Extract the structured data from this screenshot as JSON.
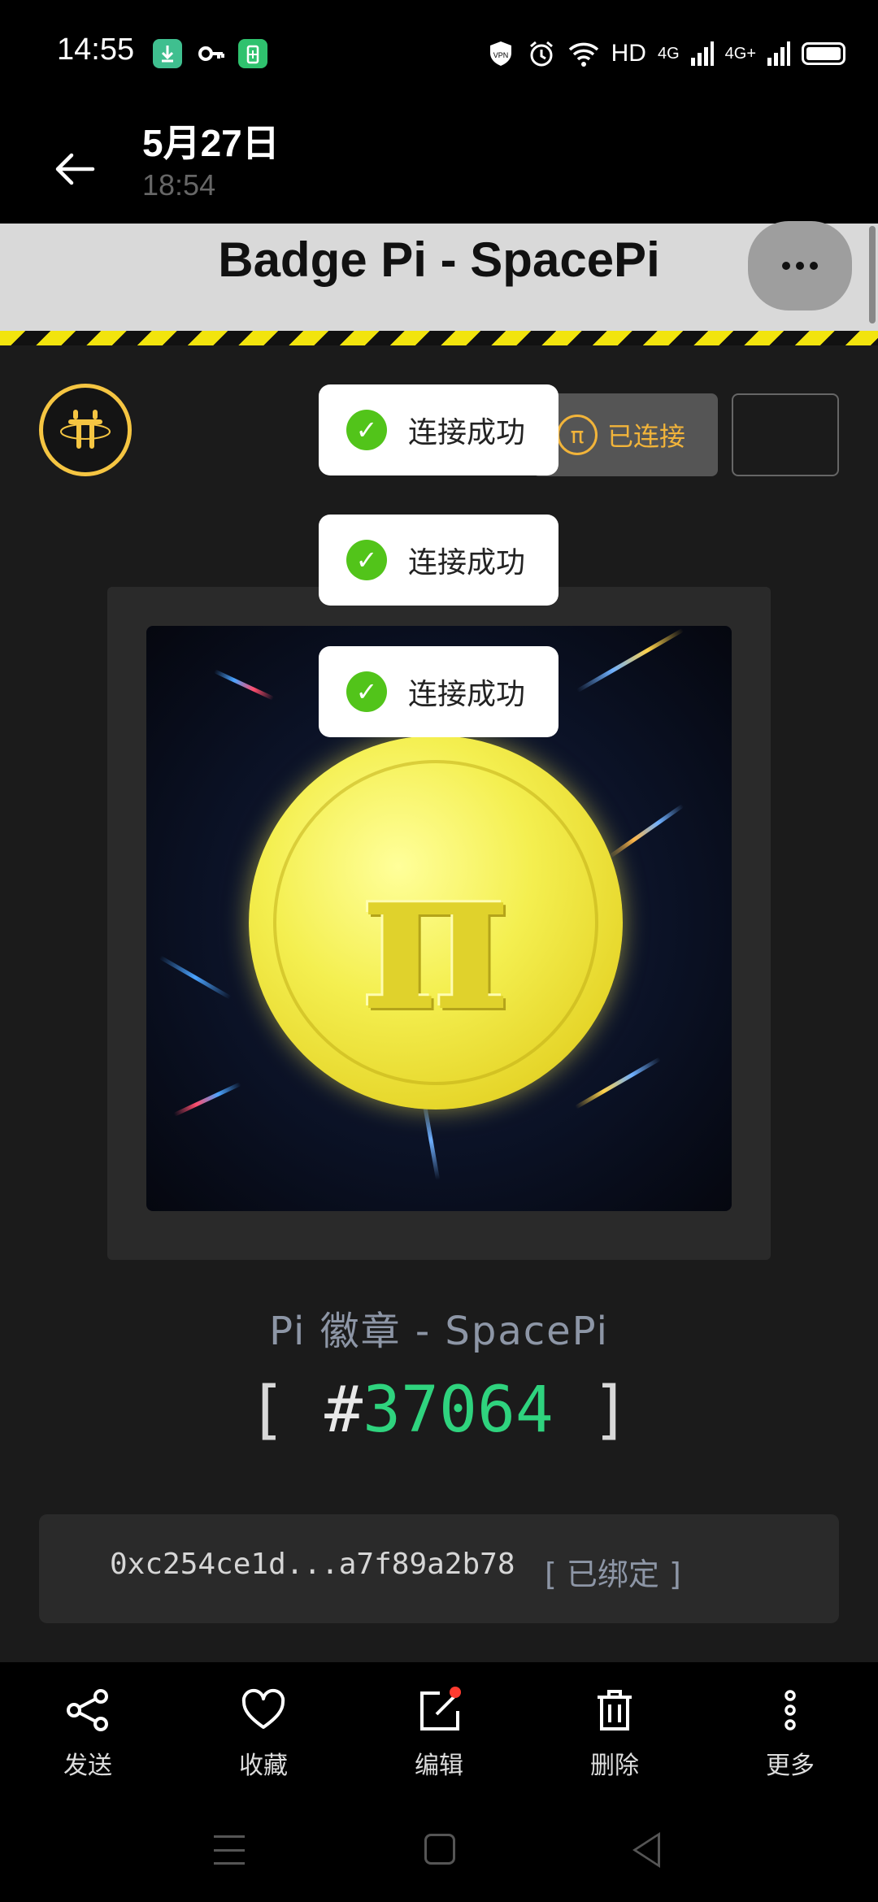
{
  "status_bar": {
    "time": "14:55",
    "network_label": "HD",
    "signal_1": "4G",
    "signal_2": "4G+",
    "icons": [
      "download-icon",
      "key-icon",
      "battery-saver-icon",
      "vpn-icon",
      "alarm-icon",
      "wifi-icon",
      "signal-icon",
      "battery-icon"
    ]
  },
  "header": {
    "date": "5月27日",
    "time": "18:54"
  },
  "web": {
    "title": "Badge Pi - SpacePi",
    "connected_label": "已连接"
  },
  "toasts": [
    {
      "text": "连接成功"
    },
    {
      "text": "连接成功"
    },
    {
      "text": "连接成功"
    }
  ],
  "badge": {
    "name": "Pi 徽章 - SpacePi",
    "open_bracket": "[",
    "hash": "#",
    "number": "37064",
    "close_bracket": "]",
    "address": "0xc254ce1d...a7f89a2b78",
    "bound_label": "[ 已绑定 ]",
    "colors": {
      "number": "#2fd37e",
      "coin": "#f4ef50",
      "accent": "#f2b43a"
    }
  },
  "toolbar": {
    "items": [
      {
        "label": "发送",
        "icon": "share-icon"
      },
      {
        "label": "收藏",
        "icon": "heart-icon"
      },
      {
        "label": "编辑",
        "icon": "edit-icon"
      },
      {
        "label": "删除",
        "icon": "trash-icon"
      },
      {
        "label": "更多",
        "icon": "more-vertical-icon"
      }
    ]
  }
}
